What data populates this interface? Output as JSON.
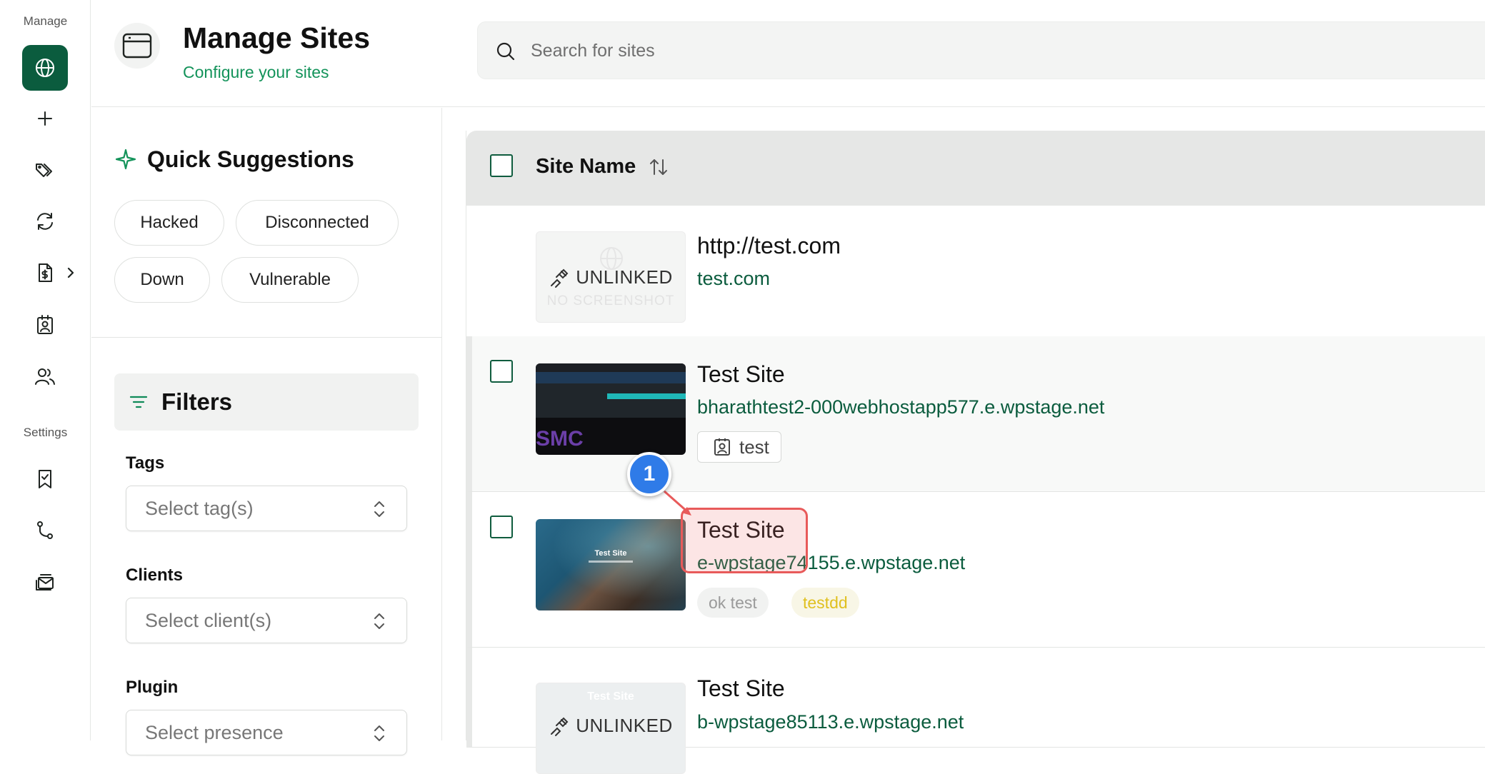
{
  "rail": {
    "manage_label": "Manage",
    "settings_label": "Settings",
    "items": [
      {
        "icon": "globe-icon",
        "active": true
      },
      {
        "icon": "plus-icon"
      },
      {
        "icon": "tags-icon"
      },
      {
        "icon": "refresh-icon"
      },
      {
        "icon": "report-icon",
        "has_submenu": true
      },
      {
        "icon": "client-icon"
      },
      {
        "icon": "users-icon"
      }
    ],
    "settings_items": [
      {
        "icon": "bookmark-icon"
      },
      {
        "icon": "git-branch-icon"
      },
      {
        "icon": "mail-stack-icon"
      }
    ]
  },
  "header": {
    "icon": "browser-window-icon",
    "title": "Manage Sites",
    "subtitle": "Configure your sites",
    "search_placeholder": "Search for sites"
  },
  "quick_suggestions": {
    "title": "Quick Suggestions",
    "chips": [
      "Hacked",
      "Disconnected",
      "Down",
      "Vulnerable"
    ]
  },
  "filters": {
    "title": "Filters",
    "tags_label": "Tags",
    "tags_placeholder": "Select tag(s)",
    "clients_label": "Clients",
    "clients_placeholder": "Select client(s)",
    "plugin_label": "Plugin",
    "plugin_placeholder": "Select presence"
  },
  "table": {
    "column_site_name": "Site Name",
    "rows": [
      {
        "name": "http://test.com",
        "url": "test.com",
        "thumbnail": "unlinked",
        "unlinked_label": "UNLINKED",
        "ghost_text": "NO SCREENSHOT"
      },
      {
        "name": "Test Site",
        "url": "bharathtest2-000webhostapp577.e.wpstage.net",
        "thumbnail": "dark-site",
        "client_tag": "test"
      },
      {
        "name": "Test Site",
        "url": "e-wpstage74155.e.wpstage.net",
        "thumbnail": "coast-site",
        "tags": [
          {
            "label": "ok test",
            "bg": "#f1f2f1",
            "fg": "#9a9a9a"
          },
          {
            "label": "testdd",
            "bg": "#f8f6e6",
            "fg": "#e0c020"
          }
        ]
      },
      {
        "name": "Test Site",
        "url": "b-wpstage85113.e.wpstage.net",
        "thumbnail": "unlinked",
        "unlinked_label": "UNLINKED",
        "ghost_text": "Test Site"
      }
    ]
  },
  "annotation": {
    "badge": "1",
    "color": "#e85a5a",
    "badge_color": "#2f7be8"
  },
  "colors": {
    "accent": "#0b5c3e",
    "accent_text": "#13935a"
  }
}
